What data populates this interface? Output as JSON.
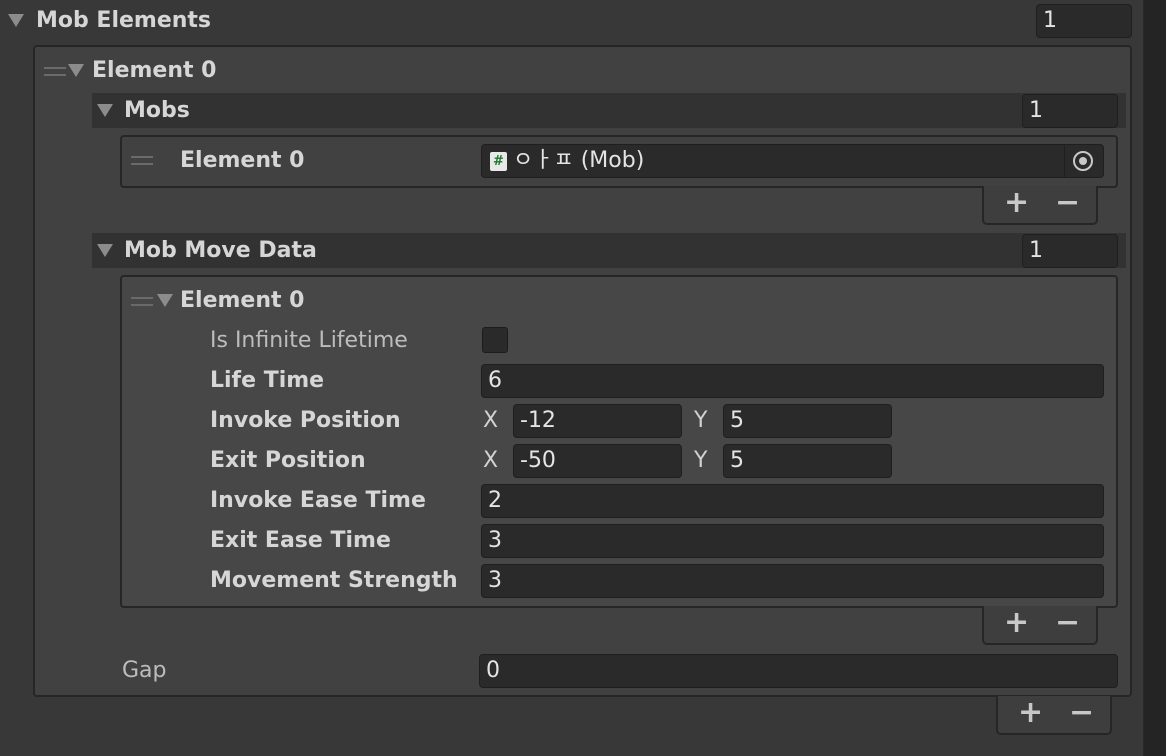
{
  "mob_elements": {
    "label": "Mob Elements",
    "size": "1",
    "element0": {
      "label": "Element 0",
      "mobs": {
        "label": "Mobs",
        "size": "1",
        "items": [
          {
            "label": "Element 0",
            "value": "ㅇㅏㅍ (Mob)",
            "icon": "script-hash-icon"
          }
        ]
      },
      "mob_move_data": {
        "label": "Mob Move Data",
        "size": "1",
        "element0": {
          "label": "Element 0",
          "is_infinite_lifetime": {
            "label": "Is Infinite Lifetime",
            "checked": false
          },
          "life_time": {
            "label": "Life Time",
            "value": "6"
          },
          "invoke_position": {
            "label": "Invoke Position",
            "x_label": "X",
            "x": "-12",
            "y_label": "Y",
            "y": "5"
          },
          "exit_position": {
            "label": "Exit Position",
            "x_label": "X",
            "x": "-50",
            "y_label": "Y",
            "y": "5"
          },
          "invoke_ease_time": {
            "label": "Invoke Ease Time",
            "value": "2"
          },
          "exit_ease_time": {
            "label": "Exit Ease Time",
            "value": "3"
          },
          "movement_strength": {
            "label": "Movement Strength",
            "value": "3"
          }
        }
      },
      "gap": {
        "label": "Gap",
        "value": "0"
      }
    }
  },
  "buttons": {
    "plus": "+",
    "minus": "−"
  },
  "colors": {
    "background": "#383838",
    "field": "#2a2a2a",
    "header": "#323232",
    "text": "#d2d2d2"
  }
}
